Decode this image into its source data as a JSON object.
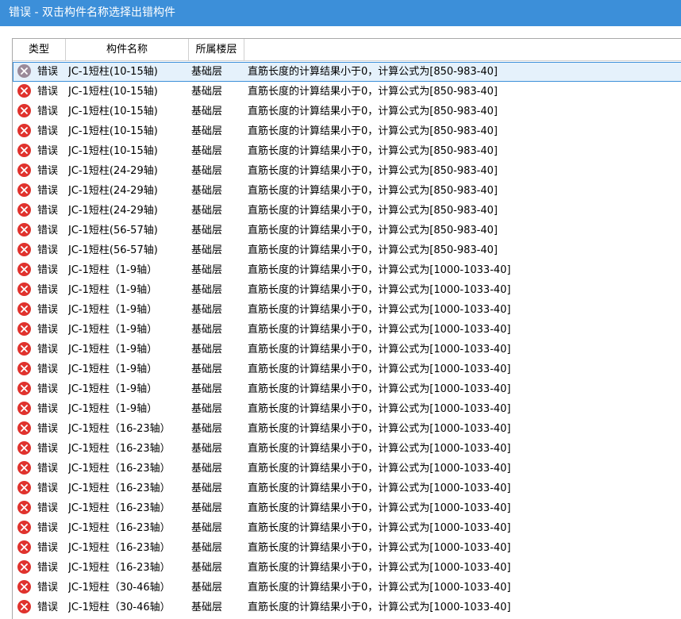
{
  "window": {
    "title": "错误 - 双击构件名称选择出错构件"
  },
  "table": {
    "headers": {
      "type": "类型",
      "name": "构件名称",
      "floor": "所属楼层",
      "desc": ""
    },
    "icon": "error-x-circle-icon",
    "colors": {
      "error_icon": "#e0322d",
      "selected_outline": "#3c8fd9"
    },
    "rows": [
      {
        "type": "错误",
        "name": "JC-1短柱(10-15轴)",
        "floor": "基础层",
        "desc": "直筋长度的计算结果小于0，计算公式为[850-983-40]",
        "selected": true
      },
      {
        "type": "错误",
        "name": "JC-1短柱(10-15轴)",
        "floor": "基础层",
        "desc": "直筋长度的计算结果小于0，计算公式为[850-983-40]"
      },
      {
        "type": "错误",
        "name": "JC-1短柱(10-15轴)",
        "floor": "基础层",
        "desc": "直筋长度的计算结果小于0，计算公式为[850-983-40]"
      },
      {
        "type": "错误",
        "name": "JC-1短柱(10-15轴)",
        "floor": "基础层",
        "desc": "直筋长度的计算结果小于0，计算公式为[850-983-40]"
      },
      {
        "type": "错误",
        "name": "JC-1短柱(10-15轴)",
        "floor": "基础层",
        "desc": "直筋长度的计算结果小于0，计算公式为[850-983-40]"
      },
      {
        "type": "错误",
        "name": "JC-1短柱(24-29轴)",
        "floor": "基础层",
        "desc": "直筋长度的计算结果小于0，计算公式为[850-983-40]"
      },
      {
        "type": "错误",
        "name": "JC-1短柱(24-29轴)",
        "floor": "基础层",
        "desc": "直筋长度的计算结果小于0，计算公式为[850-983-40]"
      },
      {
        "type": "错误",
        "name": "JC-1短柱(24-29轴)",
        "floor": "基础层",
        "desc": "直筋长度的计算结果小于0，计算公式为[850-983-40]"
      },
      {
        "type": "错误",
        "name": "JC-1短柱(56-57轴)",
        "floor": "基础层",
        "desc": "直筋长度的计算结果小于0，计算公式为[850-983-40]"
      },
      {
        "type": "错误",
        "name": "JC-1短柱(56-57轴)",
        "floor": "基础层",
        "desc": "直筋长度的计算结果小于0，计算公式为[850-983-40]"
      },
      {
        "type": "错误",
        "name": "JC-1短柱（1-9轴）",
        "floor": "基础层",
        "desc": "直筋长度的计算结果小于0，计算公式为[1000-1033-40]"
      },
      {
        "type": "错误",
        "name": "JC-1短柱（1-9轴）",
        "floor": "基础层",
        "desc": "直筋长度的计算结果小于0，计算公式为[1000-1033-40]"
      },
      {
        "type": "错误",
        "name": "JC-1短柱（1-9轴）",
        "floor": "基础层",
        "desc": "直筋长度的计算结果小于0，计算公式为[1000-1033-40]"
      },
      {
        "type": "错误",
        "name": "JC-1短柱（1-9轴）",
        "floor": "基础层",
        "desc": "直筋长度的计算结果小于0，计算公式为[1000-1033-40]"
      },
      {
        "type": "错误",
        "name": "JC-1短柱（1-9轴）",
        "floor": "基础层",
        "desc": "直筋长度的计算结果小于0，计算公式为[1000-1033-40]"
      },
      {
        "type": "错误",
        "name": "JC-1短柱（1-9轴）",
        "floor": "基础层",
        "desc": "直筋长度的计算结果小于0，计算公式为[1000-1033-40]"
      },
      {
        "type": "错误",
        "name": "JC-1短柱（1-9轴）",
        "floor": "基础层",
        "desc": "直筋长度的计算结果小于0，计算公式为[1000-1033-40]"
      },
      {
        "type": "错误",
        "name": "JC-1短柱（1-9轴）",
        "floor": "基础层",
        "desc": "直筋长度的计算结果小于0，计算公式为[1000-1033-40]"
      },
      {
        "type": "错误",
        "name": "JC-1短柱（16-23轴）",
        "floor": "基础层",
        "desc": "直筋长度的计算结果小于0，计算公式为[1000-1033-40]"
      },
      {
        "type": "错误",
        "name": "JC-1短柱（16-23轴）",
        "floor": "基础层",
        "desc": "直筋长度的计算结果小于0，计算公式为[1000-1033-40]"
      },
      {
        "type": "错误",
        "name": "JC-1短柱（16-23轴）",
        "floor": "基础层",
        "desc": "直筋长度的计算结果小于0，计算公式为[1000-1033-40]"
      },
      {
        "type": "错误",
        "name": "JC-1短柱（16-23轴）",
        "floor": "基础层",
        "desc": "直筋长度的计算结果小于0，计算公式为[1000-1033-40]"
      },
      {
        "type": "错误",
        "name": "JC-1短柱（16-23轴）",
        "floor": "基础层",
        "desc": "直筋长度的计算结果小于0，计算公式为[1000-1033-40]"
      },
      {
        "type": "错误",
        "name": "JC-1短柱（16-23轴）",
        "floor": "基础层",
        "desc": "直筋长度的计算结果小于0，计算公式为[1000-1033-40]"
      },
      {
        "type": "错误",
        "name": "JC-1短柱（16-23轴）",
        "floor": "基础层",
        "desc": "直筋长度的计算结果小于0，计算公式为[1000-1033-40]"
      },
      {
        "type": "错误",
        "name": "JC-1短柱（16-23轴）",
        "floor": "基础层",
        "desc": "直筋长度的计算结果小于0，计算公式为[1000-1033-40]"
      },
      {
        "type": "错误",
        "name": "JC-1短柱（30-46轴）",
        "floor": "基础层",
        "desc": "直筋长度的计算结果小于0，计算公式为[1000-1033-40]"
      },
      {
        "type": "错误",
        "name": "JC-1短柱（30-46轴）",
        "floor": "基础层",
        "desc": "直筋长度的计算结果小于0，计算公式为[1000-1033-40]"
      }
    ]
  }
}
